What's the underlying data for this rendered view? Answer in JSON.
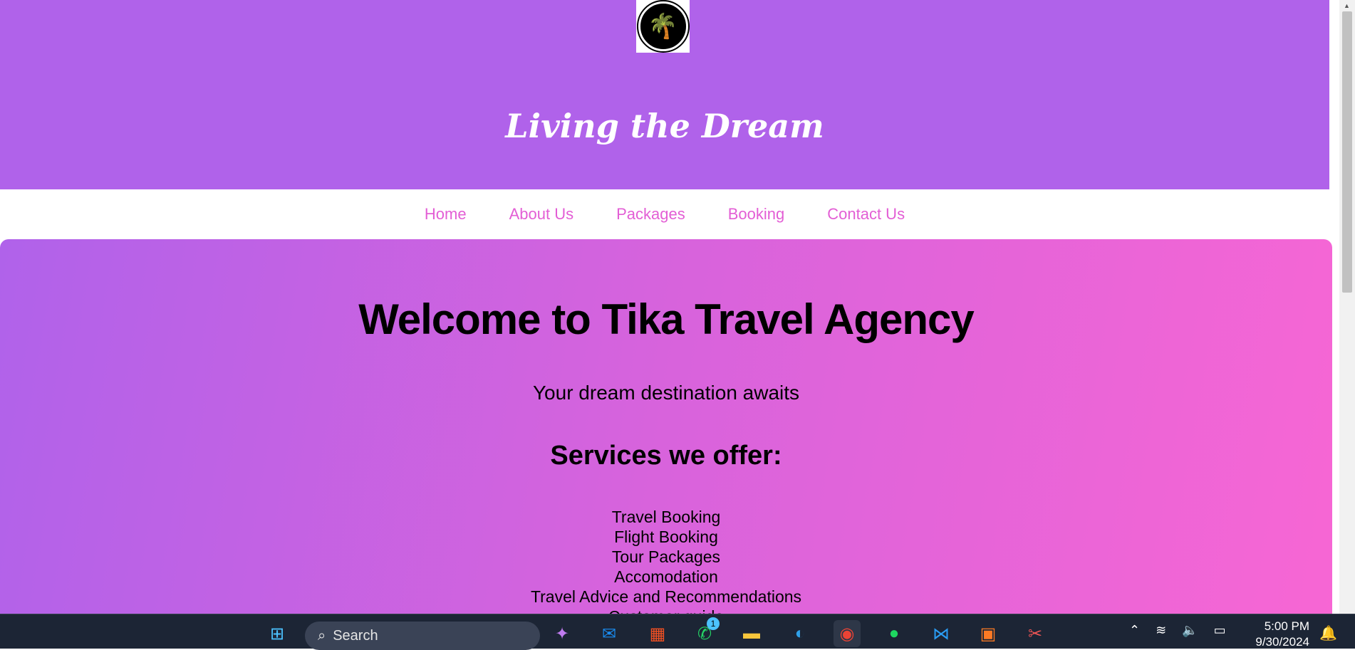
{
  "header": {
    "title": "Living the Dream"
  },
  "nav": [
    "Home",
    "About Us",
    "Packages",
    "Booking",
    "Contact Us"
  ],
  "main": {
    "heading": "Welcome to Tika Travel Agency",
    "subtitle": "Your dream destination awaits",
    "services_heading": "Services we offer:",
    "services": [
      "Travel Booking",
      "Flight Booking",
      "Tour Packages",
      "Accomodation",
      "Travel Advice and Recommendations",
      "Customer guide"
    ]
  },
  "taskbar": {
    "search_placeholder": "Search",
    "whatsapp_badge": "1",
    "time": "5:00 PM",
    "date": "9/30/2024"
  },
  "colors": {
    "header": "#b062ea",
    "nav_link": "#e35ed5",
    "gradient_end": "#f766d4"
  }
}
